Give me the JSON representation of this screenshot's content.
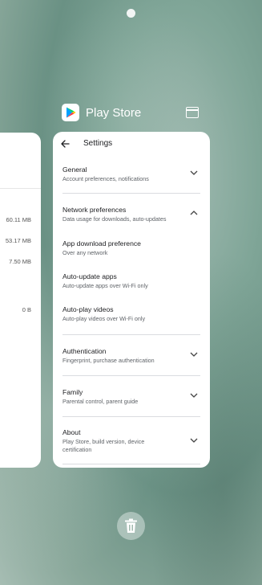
{
  "app_header": {
    "name": "Play Store",
    "icon": "google-play-icon",
    "window_icon": "split-window-icon"
  },
  "left_card": {
    "sizes": [
      "60.11 MB",
      "53.17 MB",
      "7.50 MB",
      "0 B"
    ]
  },
  "settings": {
    "title": "Settings",
    "back_icon": "arrow-left-icon",
    "items": [
      {
        "title": "General",
        "subtitle": "Account preferences, notifications",
        "chevron": "down"
      },
      {
        "title": "Network preferences",
        "subtitle": "Data usage for downloads, auto-updates",
        "chevron": "up"
      },
      {
        "title": "App download preference",
        "subtitle": "Over any network"
      },
      {
        "title": "Auto-update apps",
        "subtitle": "Auto-update apps over Wi-Fi only"
      },
      {
        "title": "Auto-play videos",
        "subtitle": "Auto-play videos over Wi-Fi only"
      },
      {
        "title": "Authentication",
        "subtitle": "Fingerprint, purchase authentication",
        "chevron": "down"
      },
      {
        "title": "Family",
        "subtitle": "Parental control, parent guide",
        "chevron": "down"
      },
      {
        "title": "About",
        "subtitle": "Play Store, build version, device certification",
        "chevron": "down"
      }
    ]
  },
  "trash_button": {
    "icon": "trash-icon"
  },
  "colors": {
    "accent": "#ffffff",
    "wallpaper": "#7fa597"
  }
}
